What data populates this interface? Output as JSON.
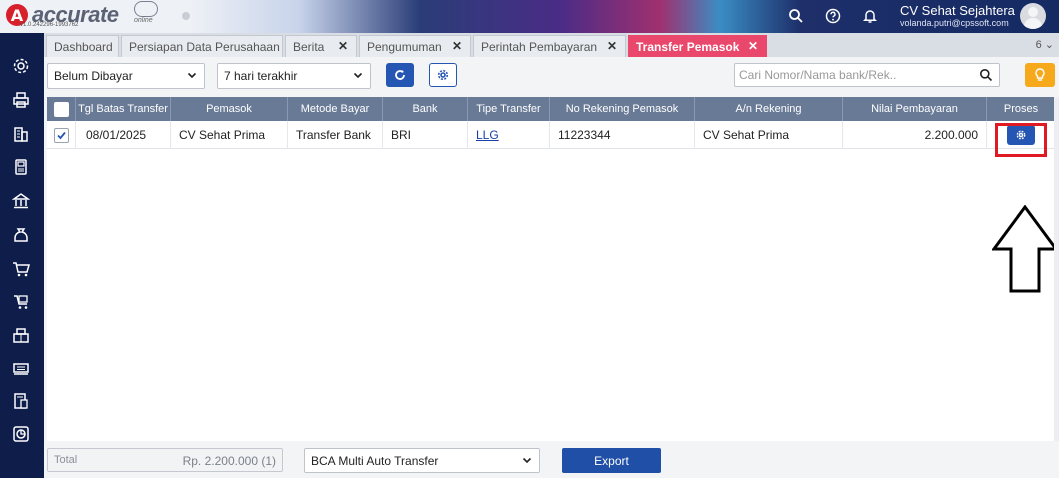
{
  "app": {
    "logo_text": "accurate",
    "version": "v1.0.242296-1993762",
    "online_label": "online"
  },
  "header": {
    "company": "CV Sehat Sejahtera",
    "email": "volanda.putri@cpssoft.com",
    "icons": [
      "search-icon",
      "help-icon",
      "bell-icon"
    ]
  },
  "tabs": [
    {
      "label": "Dashboard",
      "closable": false
    },
    {
      "label": "Persiapan Data Perusahaan",
      "closable": false
    },
    {
      "label": "Berita",
      "closable": true
    },
    {
      "label": "Pengumuman",
      "closable": true
    },
    {
      "label": "Perintah Pembayaran",
      "closable": true
    },
    {
      "label": "Transfer Pemasok",
      "closable": true,
      "active": true
    }
  ],
  "tab_count": "6",
  "filters": {
    "status": "Belum Dibayar",
    "period": "7 hari terakhir",
    "search_placeholder": "Cari Nomor/Nama bank/Rek.."
  },
  "table": {
    "columns": [
      "Tgl Batas Transfer",
      "Pemasok",
      "Metode Bayar",
      "Bank",
      "Tipe Transfer",
      "No Rekening Pemasok",
      "A/n Rekening",
      "Nilai Pembayaran",
      "Proses"
    ],
    "rows": [
      {
        "checked": true,
        "tgl": "08/01/2025",
        "pemasok": "CV Sehat Prima",
        "metode": "Transfer Bank",
        "bank": "BRI",
        "tipe": "LLG",
        "norek": "11223344",
        "an": "CV Sehat Prima",
        "nilai": "2.200.000"
      }
    ]
  },
  "footer": {
    "total_label": "Total",
    "total_value": "Rp. 2.200.000 (1)",
    "export_format": "BCA Multi Auto Transfer",
    "export_label": "Export"
  },
  "colors": {
    "sidebar": "#0e1d49",
    "active_tab": "#e9476b",
    "primary": "#2656b4",
    "table_header": "#687a96",
    "highlight": "#e01a22",
    "bulb": "#f6a91b"
  }
}
